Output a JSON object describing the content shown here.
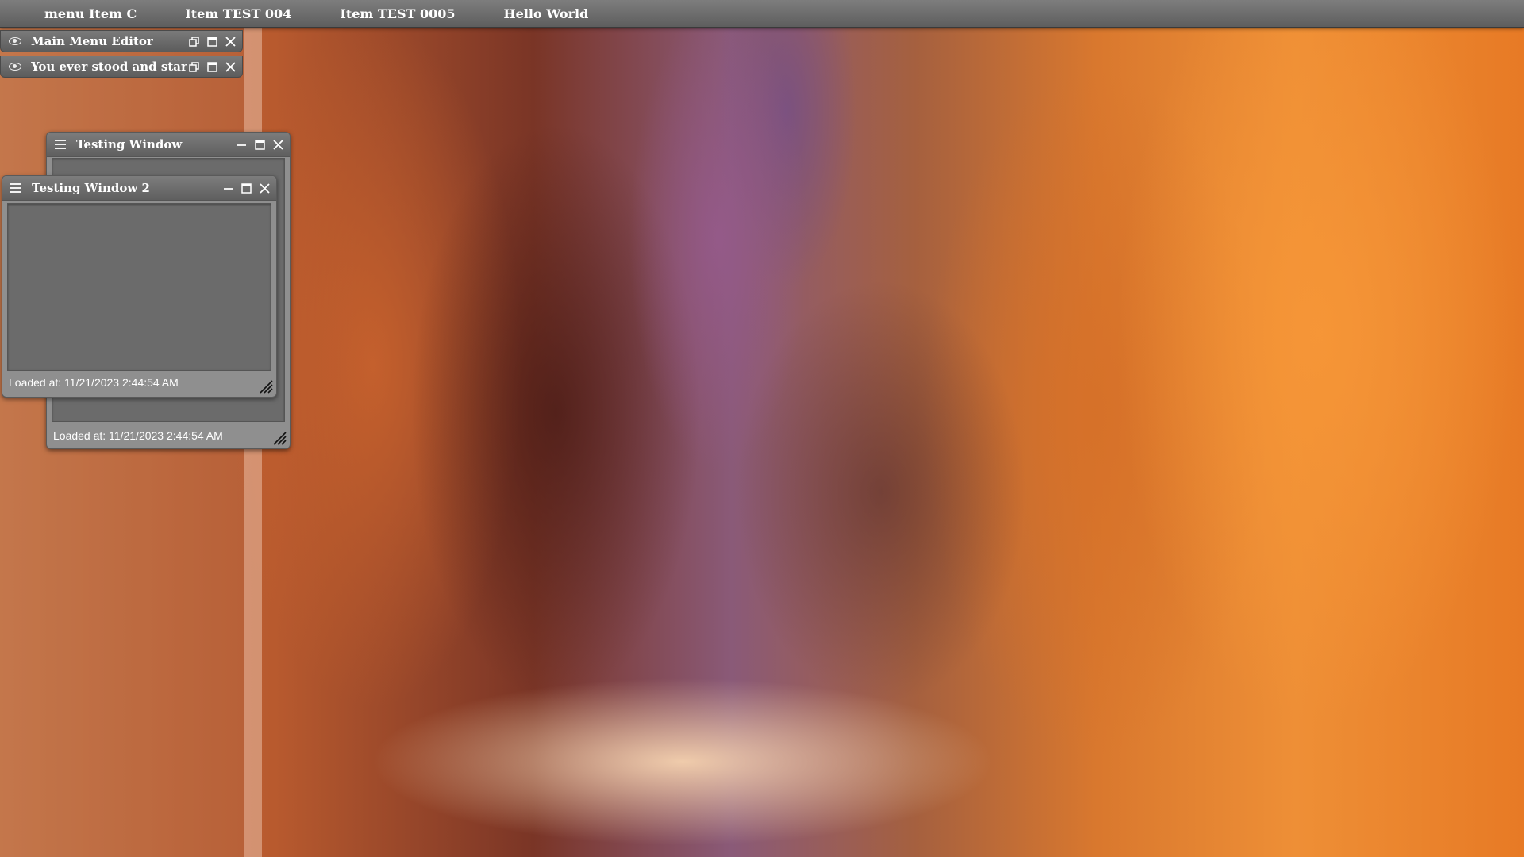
{
  "menu_bar": {
    "items": [
      {
        "label": "menu Item C"
      },
      {
        "label": "Item TEST 004"
      },
      {
        "label": "Item TEST 0005"
      },
      {
        "label": "Hello World"
      }
    ]
  },
  "minimized_panels": [
    {
      "title": "Main Menu Editor",
      "icon": "eye-icon"
    },
    {
      "title": "You ever stood and stared",
      "icon": "eye-icon"
    }
  ],
  "windows": {
    "testing_window": {
      "title": "Testing Window",
      "footer": "Loaded at: 11/21/2023 2:44:54 AM"
    },
    "testing_window_2": {
      "title": "Testing Window 2",
      "footer": "Loaded at: 11/21/2023 2:44:54 AM"
    }
  },
  "colors": {
    "titlebar": "#6b6b6b",
    "window_body": "#8f8f8f",
    "content_panel": "#6b6b6b",
    "text": "#ffffff"
  }
}
